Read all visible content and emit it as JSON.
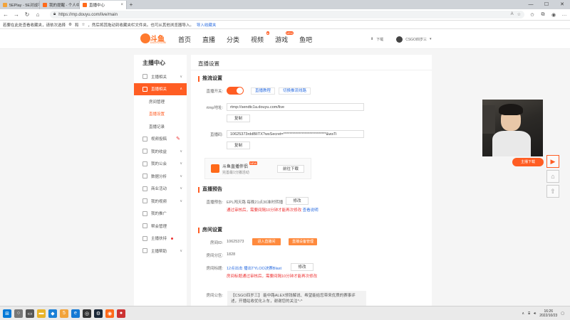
{
  "browser": {
    "tabs": [
      {
        "label": "5EPlay - 5E对战平台首页",
        "active": false
      },
      {
        "label": "我的提醒 - 个人中心 - 斗鱼",
        "active": false
      },
      {
        "label": "直播中心",
        "active": true
      }
    ],
    "url": "https://mp.douyu.com/live/main",
    "favbar_text": "若要在此处查看收藏夹，请依次选择",
    "favbar_text2": "和",
    "favbar_text3": "，然后将其拖动到收藏夹栏文件夹。也可从其他浏览器导入。",
    "favbar_link": "导入收藏夹"
  },
  "site": {
    "logo_text": "斗鱼",
    "logo_sub": "DOUYU.COM",
    "nav": [
      {
        "label": "首页",
        "badge": ""
      },
      {
        "label": "直播",
        "badge": ""
      },
      {
        "label": "分类",
        "badge": ""
      },
      {
        "label": "视频",
        "badge": "●"
      },
      {
        "label": "游戏",
        "badge": "NEW"
      },
      {
        "label": "鱼吧",
        "badge": ""
      }
    ],
    "download_label": "下载",
    "username": "CSGO四岁三"
  },
  "sidebar": {
    "title": "主播中心",
    "items": [
      {
        "label": "主播相关",
        "kind": "item",
        "arrow": "∨"
      },
      {
        "label": "直播相关",
        "kind": "active",
        "arrow": "∧"
      },
      {
        "label": "房间管理",
        "kind": "sub",
        "arrow": ""
      },
      {
        "label": "直播设置",
        "kind": "current",
        "arrow": ""
      },
      {
        "label": "直播记录",
        "kind": "sub",
        "arrow": ""
      },
      {
        "label": "视频投稿",
        "kind": "item",
        "arrow": ""
      },
      {
        "label": "我的收益",
        "kind": "item",
        "arrow": "∨"
      },
      {
        "label": "我的公会",
        "kind": "item",
        "arrow": "∨"
      },
      {
        "label": "数据分析",
        "kind": "item",
        "arrow": "∨"
      },
      {
        "label": "商业活动",
        "kind": "item",
        "arrow": "∨"
      },
      {
        "label": "我的视频",
        "kind": "item",
        "arrow": "∨"
      },
      {
        "label": "我的推广",
        "kind": "item",
        "arrow": ""
      },
      {
        "label": "帮会管理",
        "kind": "item",
        "arrow": ""
      },
      {
        "label": "主播扶持",
        "kind": "item",
        "arrow": "",
        "dot": true
      },
      {
        "label": "主播帮助",
        "kind": "item",
        "arrow": "∨"
      }
    ]
  },
  "panel": {
    "title": "直播设置",
    "stream": {
      "heading": "推流设置",
      "switch_label": "直播开关:",
      "switch_on": true,
      "link1": "直播教程",
      "link2": "切换推流线路",
      "rtmp_label": "rtmp地址:",
      "rtmp_value": "rtmp://sendtc1a.douyu.com/live",
      "copy1": "复制",
      "code_label": "直播码:",
      "code_value": "10625373rddBlITX?wsSecret=****************************&wsTi",
      "copy2": "复制"
    },
    "promo": {
      "name": "斗鱼直播伴侣",
      "tag": "NEW",
      "desc": "完善最1分播活动",
      "button": "前往下载"
    },
    "preview": {
      "heading": "直播预告",
      "label": "直播预告:",
      "value": "EPL闯天路 每晚21点30准时转播",
      "edit": "修改",
      "note": "通过审核后，需要间隔10分钟才能再次修改",
      "note_link": "查看说明"
    },
    "room": {
      "heading": "房间设置",
      "id_label": "房间ID:",
      "id_value": "10625373",
      "btn1": "进入直播间",
      "btn2": "直播设备管理",
      "cat_label": "房间分区:",
      "cat_value": "1828",
      "name_label": "房间标题:",
      "name_value": "12点出击 播出TYLOO决赛Blast",
      "name_edit": "修改",
      "name_note": "房间标题通过审核后，需要间隔10分钟才能再次修改",
      "notice_label": "房间公告:",
      "notice_value": "【CSGO四岁三】 能中路ALEX领钱解说、希望能给您带来优质的赛事评述，开播站收优化上车，谢谢您的关注^-^"
    }
  },
  "overlay": {
    "follow_button": "主播下载"
  },
  "taskbar": {
    "time": "16:26",
    "date": "2022/10/23"
  },
  "colors": {
    "accent": "#ff5d23",
    "link": "#2b6de0",
    "warning": "#e33333"
  }
}
